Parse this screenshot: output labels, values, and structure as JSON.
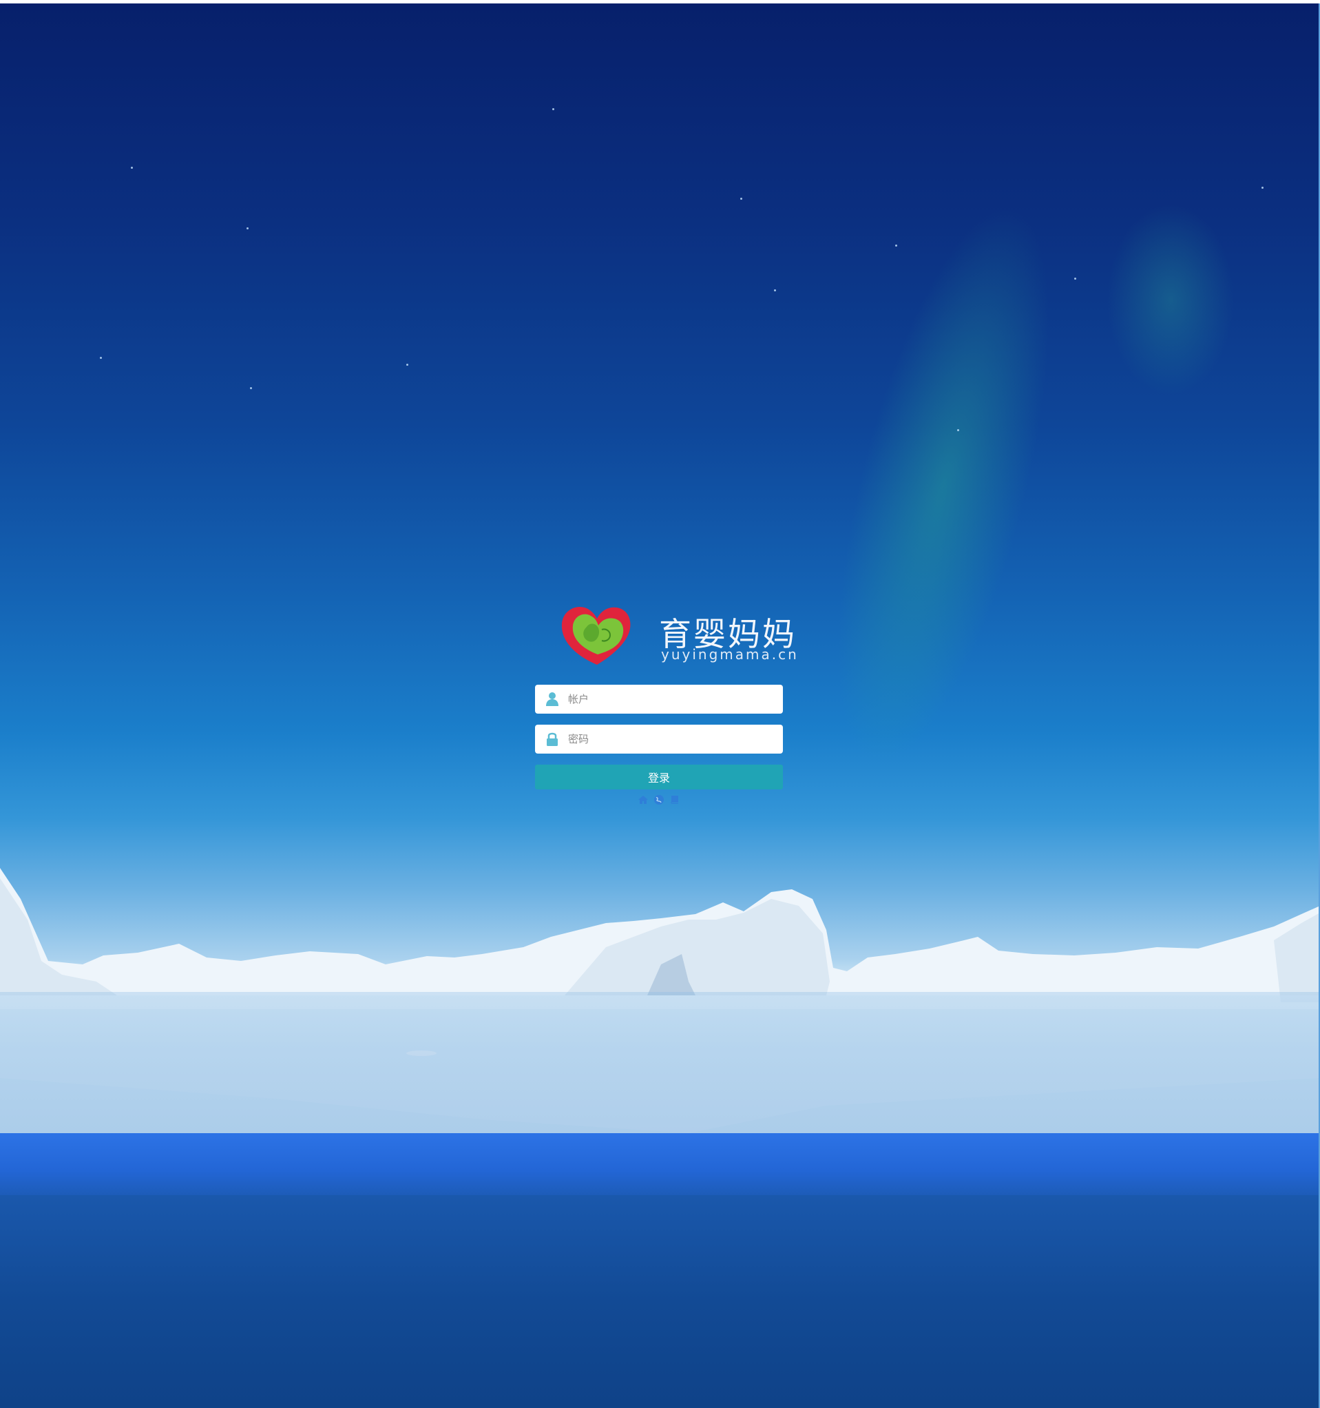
{
  "brand": {
    "title": "育婴妈妈",
    "subtitle": "yuyingmama.cn",
    "logo_icon": "heart-baby-logo"
  },
  "login_form": {
    "account_placeholder": "帐户",
    "password_placeholder": "密码",
    "submit_label": "登录",
    "account_icon": "user-icon",
    "password_icon": "lock-icon"
  },
  "footer_links": [
    {
      "icon": "home-icon"
    },
    {
      "icon": "globe-icon"
    },
    {
      "icon": "book-icon"
    }
  ],
  "colors": {
    "button": "#20a4b5",
    "input_icon": "#5bbcd4",
    "link_icon": "#2f7fd8"
  }
}
